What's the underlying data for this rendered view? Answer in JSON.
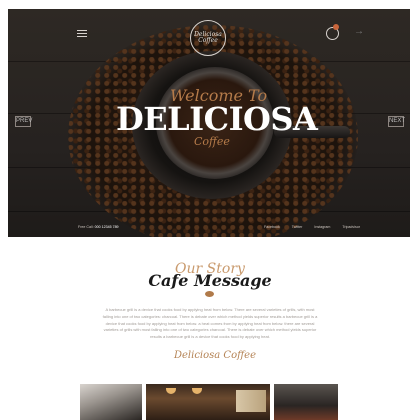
{
  "hero": {
    "logo_text": "Deliciosa Coffee",
    "welcome_script": "Welcome To",
    "brand_name": "DELICIOSA",
    "coffee_script": "Coffee",
    "prev_label": "PREV",
    "next_label": "NEXT",
    "call_label": "Free Call:",
    "call_number": "000 12345 789",
    "social_links": [
      "Facebook",
      "Twitter",
      "Instagram",
      "Tripadvisor"
    ]
  },
  "story": {
    "script_heading": "Our Story",
    "title": "Cafe Message",
    "body": "A barbecue grill is a device that cooks food by applying heat from below. There are several varieties of grills, with most falling into one of two categories: charcoal. There is debate over which method yields superior results a barbecue grill is a device that cooks food by applying heat from below. a heat comes from by applying heat from below. there are several varieties of grills with most falling into one of two categories charcoal. There is debate over which method yields superior results a barbecue grill is a device that cooks food by applying heat.",
    "signature": "Deliciosa Coffee"
  }
}
